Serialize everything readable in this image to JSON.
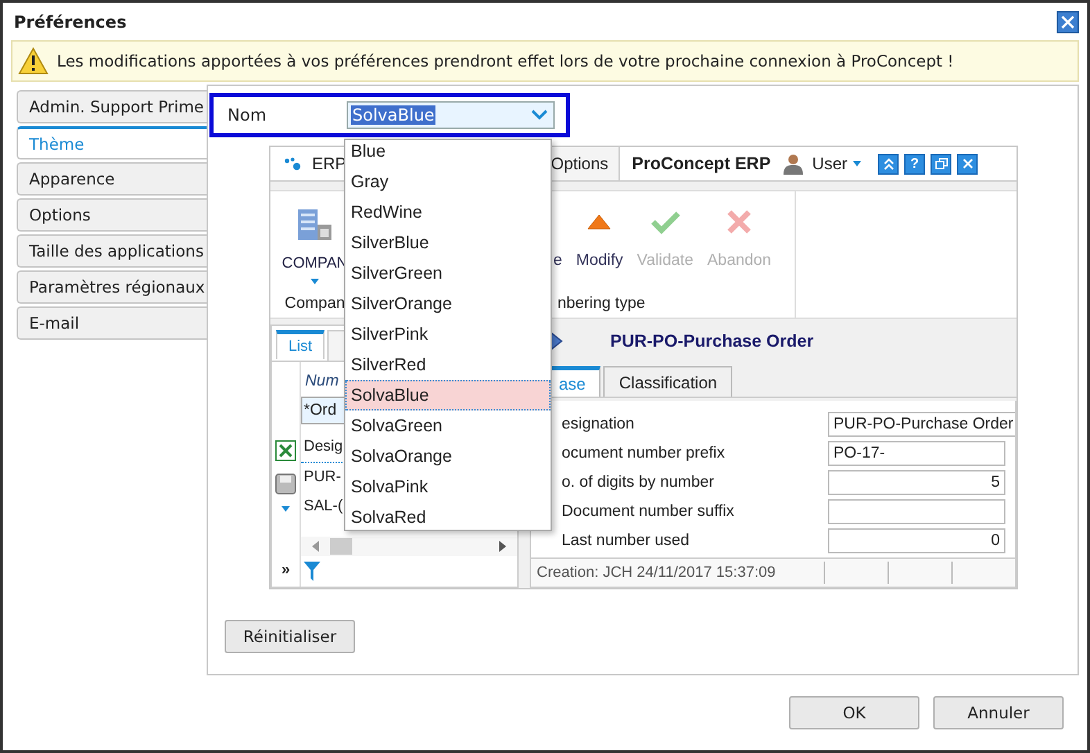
{
  "window": {
    "title": "Préférences"
  },
  "warning": "Les modifications apportées à vos préférences prendront effet lors de votre prochaine connexion à ProConcept !",
  "sidebar": {
    "items": [
      {
        "label": "Admin. Support Prime",
        "selected": false
      },
      {
        "label": "Thème",
        "selected": true
      },
      {
        "label": "Apparence",
        "selected": false
      },
      {
        "label": "Options",
        "selected": false
      },
      {
        "label": "Taille des applications",
        "selected": false
      },
      {
        "label": "Paramètres régionaux",
        "selected": false
      },
      {
        "label": "E-mail",
        "selected": false
      }
    ]
  },
  "theme": {
    "label": "Nom",
    "value": "SolvaBlue",
    "options": [
      {
        "label": "Blue",
        "selected": false
      },
      {
        "label": "Gray",
        "selected": false
      },
      {
        "label": "RedWine",
        "selected": false
      },
      {
        "label": "SilverBlue",
        "selected": false
      },
      {
        "label": "SilverGreen",
        "selected": false
      },
      {
        "label": "SilverOrange",
        "selected": false
      },
      {
        "label": "SilverPink",
        "selected": false
      },
      {
        "label": "SilverRed",
        "selected": false
      },
      {
        "label": "SolvaBlue",
        "selected": true
      },
      {
        "label": "SolvaGreen",
        "selected": false
      },
      {
        "label": "SolvaOrange",
        "selected": false
      },
      {
        "label": "SolvaPink",
        "selected": false
      },
      {
        "label": "SolvaRed",
        "selected": false
      }
    ]
  },
  "preview": {
    "app_menu": "ERP",
    "tab": "Options",
    "app_title": "ProConcept ERP",
    "user": "User",
    "help": "?",
    "ribbon": {
      "left_button": "COMPAN",
      "left_group": "Compan",
      "group": "nbering type",
      "buttons": [
        {
          "label": "e",
          "kind": "none",
          "disabled": false
        },
        {
          "label": "Modify",
          "kind": "modify",
          "disabled": false
        },
        {
          "label": "Validate",
          "kind": "validate",
          "disabled": true
        },
        {
          "label": "Abandon",
          "kind": "abandon",
          "disabled": true
        }
      ]
    },
    "list": {
      "tabs": [
        {
          "label": "List",
          "selected": true
        }
      ],
      "filter_label": "Num",
      "filter_value": "*Ord",
      "column": "Desig",
      "rows": [
        "PUR-",
        "SAL-("
      ],
      "expand": "»"
    },
    "detail": {
      "title": "PUR-PO-Purchase Order",
      "tabs": [
        {
          "label": "ase",
          "selected": true
        },
        {
          "label": "Classification",
          "selected": false
        }
      ],
      "fields": [
        {
          "label": "esignation",
          "value": "PUR-PO-Purchase Order",
          "kind": "text"
        },
        {
          "label": "ocument number prefix",
          "value": "PO-17-",
          "kind": "text"
        },
        {
          "label": "o. of digits by number",
          "value": "5",
          "kind": "number"
        },
        {
          "label": "Document number suffix",
          "kind": "text"
        },
        {
          "label": "Last number used",
          "value": "0",
          "kind": "number"
        }
      ],
      "status": "Creation: JCH 24/11/2017 15:37:09"
    }
  },
  "reset_button": "Réinitialiser",
  "buttons": [
    "OK",
    "Annuler"
  ]
}
